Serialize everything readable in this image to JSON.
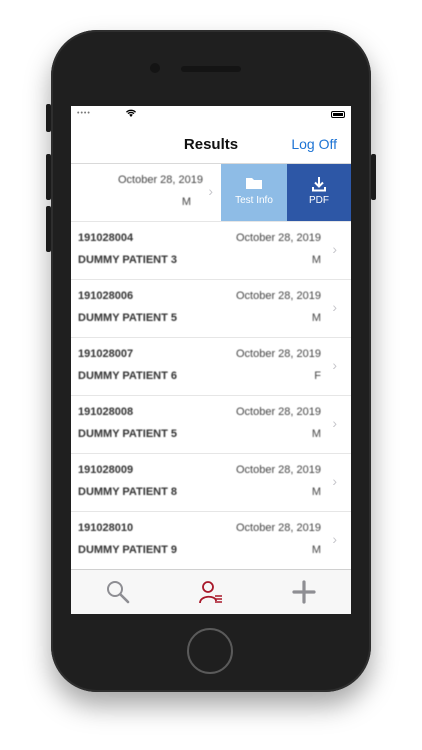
{
  "nav": {
    "title": "Results",
    "logoff_label": "Log Off"
  },
  "swiped_row": {
    "date": "October 28, 2019",
    "sex": "M",
    "actions": [
      {
        "label": "Test Info",
        "icon": "folder-icon",
        "color": "#8ebce6"
      },
      {
        "label": "PDF",
        "icon": "download-icon",
        "color": "#2d57a6"
      }
    ]
  },
  "rows": [
    {
      "id": "191028004",
      "name": "DUMMY PATIENT 3",
      "date": "October 28, 2019",
      "sex": "M"
    },
    {
      "id": "191028006",
      "name": "DUMMY PATIENT 5",
      "date": "October 28, 2019",
      "sex": "M"
    },
    {
      "id": "191028007",
      "name": "DUMMY PATIENT 6",
      "date": "October 28, 2019",
      "sex": "F"
    },
    {
      "id": "191028008",
      "name": "DUMMY PATIENT 5",
      "date": "October 28, 2019",
      "sex": "M"
    },
    {
      "id": "191028009",
      "name": "DUMMY PATIENT 8",
      "date": "October 28, 2019",
      "sex": "M"
    },
    {
      "id": "191028010",
      "name": "DUMMY PATIENT 9",
      "date": "October 28, 2019",
      "sex": "M"
    }
  ],
  "tabbar": {
    "items": [
      {
        "icon": "search-icon",
        "active": false
      },
      {
        "icon": "patient-list-icon",
        "active": true
      },
      {
        "icon": "plus-icon",
        "active": false
      }
    ],
    "active_color": "#a8182a",
    "inactive_color": "#8e8e93"
  },
  "colors": {
    "accent": "#1e74d4"
  }
}
